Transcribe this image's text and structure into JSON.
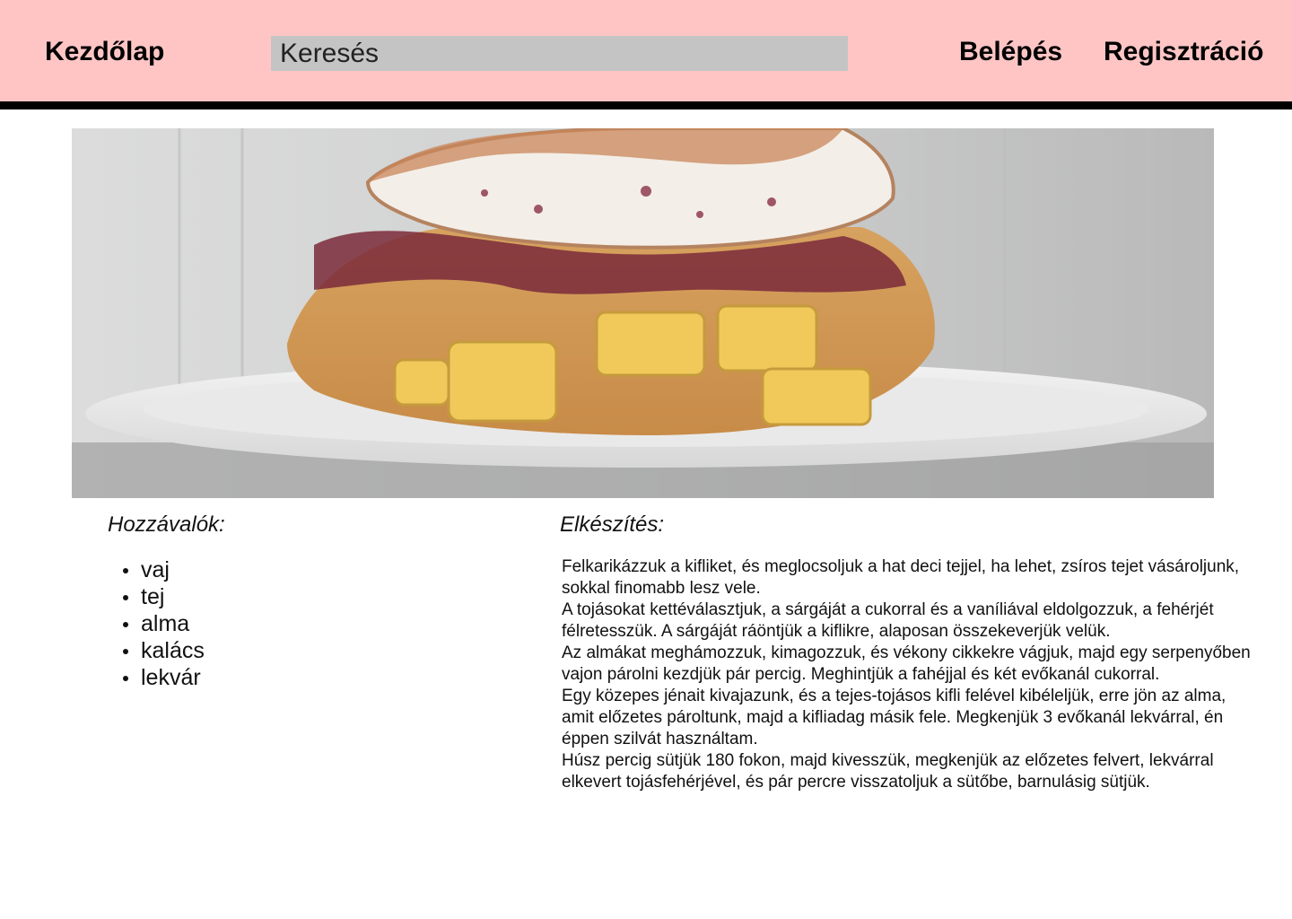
{
  "nav": {
    "home": "Kezdőlap",
    "login": "Belépés",
    "register": "Regisztráció"
  },
  "search": {
    "placeholder": "Keresés"
  },
  "hero": {
    "image": "baked apple bread pudding with jam and meringue on a white plate"
  },
  "ingredients": {
    "heading": "Hozzávalók:",
    "items": [
      "vaj",
      "tej",
      "alma",
      "kalács",
      "lekvár"
    ]
  },
  "preparation": {
    "heading": "Elkészítés:",
    "paragraphs": [
      "Felkarikázzuk a kifliket, és meglocsoljuk a hat deci tejjel, ha lehet, zsíros tejet vásároljunk, sokkal finomabb lesz vele.",
      "A tojásokat kettéválasztjuk, a sárgáját a cukorral és a vaníliával eldolgozzuk, a fehérjét félretesszük. A sárgáját ráöntjük a kiflikre, alaposan összekeverjük velük.",
      "Az almákat meghámozzuk, kimagozzuk, és vékony cikkekre vágjuk, majd egy serpenyőben vajon párolni kezdjük pár percig. Meghintjük a fahéjjal és két evőkanál cukorral.",
      "Egy közepes jénait kivajazunk, és a tejes-tojásos kifli felével kibéleljük, erre jön az alma, amit előzetes pároltunk, majd a kifliadag másik fele. Megkenjük 3 evőkanál lekvárral, én éppen szilvát használtam.",
      "Húsz percig sütjük 180 fokon, majd kivesszük, megkenjük az előzetes felvert, lekvárral elkevert tojásfehérjével, és pár percre visszatoljuk a sütőbe, barnulásig sütjük."
    ]
  },
  "colors": {
    "header_bg": "#ffc5c5",
    "header_rule": "#000000",
    "search_bg": "#c4c4c4"
  }
}
